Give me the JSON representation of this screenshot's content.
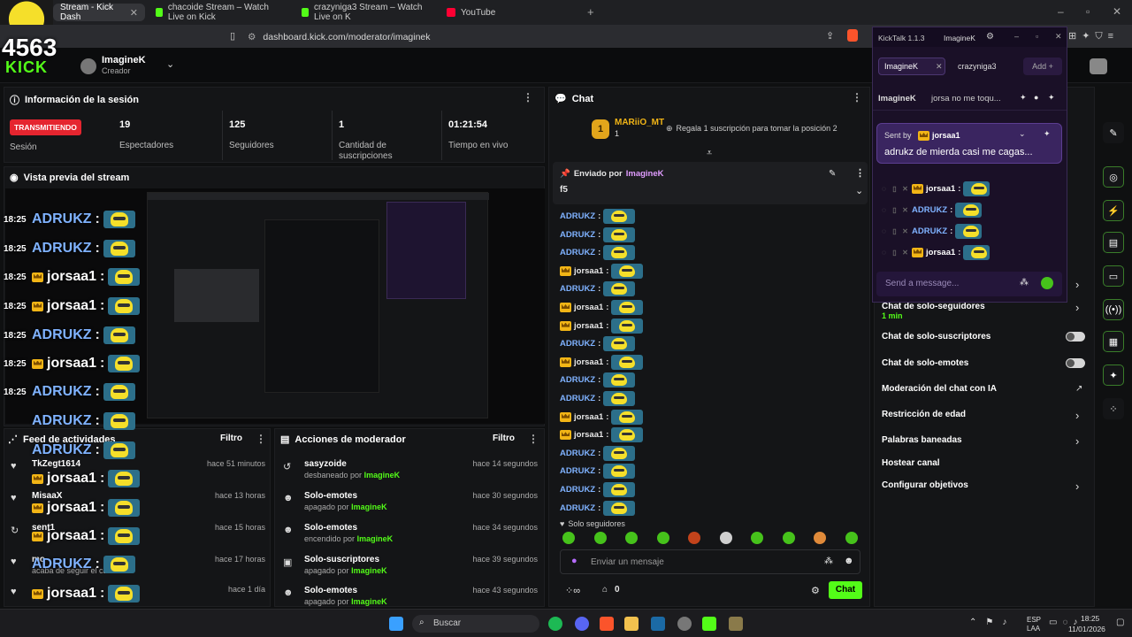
{
  "browser": {
    "tabs": [
      {
        "label": "Stream - Kick Dash",
        "active": true,
        "color": "#53fc18"
      },
      {
        "label": "chacoide Stream – Watch Live on Kick",
        "active": false,
        "color": "#53fc18"
      },
      {
        "label": "crazyniga3 Stream – Watch Live on K",
        "active": false,
        "color": "#53fc18"
      },
      {
        "label": "YouTube",
        "active": false,
        "color": "#ff0033"
      }
    ],
    "url": "dashboard.kick.com/moderator/imaginek",
    "overlay_number": "4563"
  },
  "topnav": {
    "logo": "KICK",
    "user": "ImagineK",
    "role": "Creador"
  },
  "session": {
    "title": "Información de la sesión",
    "live_badge": "TRANSMITIENDO",
    "session_label": "Sesión",
    "stats": [
      {
        "value": "19",
        "label": "Espectadores"
      },
      {
        "value": "125",
        "label": "Seguidores"
      },
      {
        "value": "1",
        "label": "Cantidad de suscripciones"
      },
      {
        "value": "01:21:54",
        "label": "Tiempo en vivo"
      }
    ]
  },
  "preview": {
    "title": "Vista previa del stream"
  },
  "overlay_chat": [
    {
      "time": "18:25",
      "name": "ADRUKZ",
      "gold": false
    },
    {
      "time": "18:25",
      "name": "ADRUKZ",
      "gold": false
    },
    {
      "time": "18:25",
      "name": "jorsaa1",
      "gold": true
    },
    {
      "time": "18:25",
      "name": "jorsaa1",
      "gold": true
    },
    {
      "time": "18:25",
      "name": "ADRUKZ",
      "gold": false
    },
    {
      "time": "18:25",
      "name": "jorsaa1",
      "gold": true
    },
    {
      "time": "18:25",
      "name": "ADRUKZ",
      "gold": false
    },
    {
      "time": "",
      "name": "ADRUKZ",
      "gold": false
    },
    {
      "time": "",
      "name": "ADRUKZ",
      "gold": false
    },
    {
      "time": "",
      "name": "jorsaa1",
      "gold": true
    },
    {
      "time": "",
      "name": "jorsaa1",
      "gold": true
    },
    {
      "time": "",
      "name": "jorsaa1",
      "gold": true
    },
    {
      "time": "",
      "name": "ADRUKZ",
      "gold": false
    },
    {
      "time": "",
      "name": "jorsaa1",
      "gold": true
    }
  ],
  "feed": {
    "title": "Feed de actividades",
    "filter": "Filtro",
    "items": [
      {
        "name": "TkZegt1614",
        "sub": "",
        "ago": "hace 51 minutos"
      },
      {
        "name": "MisaaX",
        "sub": "",
        "ago": "hace 13 horas"
      },
      {
        "name": "sent1",
        "sub": "",
        "ago": "hace 15 horas"
      },
      {
        "name": "mo",
        "sub": "acaba de seguir el canal",
        "ago": "hace 17 horas"
      },
      {
        "name": "",
        "sub": "",
        "ago": "hace 1 día"
      }
    ]
  },
  "modactions": {
    "title": "Acciones de moderador",
    "filter": "Filtro",
    "items": [
      {
        "name": "sasyzoide",
        "sub": "desbaneado por",
        "by": "ImagineK",
        "ago": "hace 14 segundos",
        "icon": "↺"
      },
      {
        "name": "Solo-emotes",
        "sub": "apagado por",
        "by": "ImagineK",
        "ago": "hace 30 segundos",
        "icon": "☻"
      },
      {
        "name": "Solo-emotes",
        "sub": "encendido por",
        "by": "ImagineK",
        "ago": "hace 34 segundos",
        "icon": "☻"
      },
      {
        "name": "Solo-suscriptores",
        "sub": "apagado por",
        "by": "ImagineK",
        "ago": "hace 39 segundos",
        "icon": "▣"
      },
      {
        "name": "Solo-emotes",
        "sub": "apagado por",
        "by": "ImagineK",
        "ago": "hace 43 segundos",
        "icon": "☻"
      }
    ]
  },
  "chat": {
    "title": "Chat",
    "top_gifter": "MARiiO_MT",
    "top_gifter_count": "1",
    "gift_cta": "Regala 1 suscripción para tomar la posición 2",
    "pinned_prefix": "Enviado por",
    "pinned_by": "ImagineK",
    "pinned_text": "f5",
    "lines": [
      "ADRUKZ",
      "ADRUKZ",
      "ADRUKZ",
      "jorsaa1",
      "ADRUKZ",
      "jorsaa1",
      "jorsaa1",
      "ADRUKZ",
      "jorsaa1",
      "ADRUKZ",
      "ADRUKZ",
      "jorsaa1",
      "jorsaa1",
      "ADRUKZ",
      "ADRUKZ",
      "ADRUKZ",
      "ADRUKZ"
    ],
    "mode": "Solo seguidores",
    "placeholder": "Enviar un mensaje",
    "count": "0",
    "send": "Chat"
  },
  "modsettings": {
    "rows": [
      {
        "label": "Chat de solo-seguidores",
        "sub": "1 min",
        "type": "chevron"
      },
      {
        "label": "Chat de solo-suscriptores",
        "sub": "",
        "type": "toggle"
      },
      {
        "label": "Chat de solo-emotes",
        "sub": "",
        "type": "toggle"
      },
      {
        "label": "Moderación del chat con IA",
        "sub": "",
        "type": "external"
      },
      {
        "label": "Restricción de edad",
        "sub": "",
        "type": "chevron"
      },
      {
        "label": "Palabras baneadas",
        "sub": "",
        "type": "chevron"
      },
      {
        "label": "Hostear canal",
        "sub": "",
        "type": "none"
      },
      {
        "label": "Configurar objetivos",
        "sub": "",
        "type": "chevron"
      }
    ]
  },
  "kicktalk": {
    "title": "KickTalk 1.1.3",
    "user": "ImagineK",
    "tabs": [
      "ImagineK",
      "crazyniga3"
    ],
    "add": "Add",
    "pinned_user": "ImagineK",
    "pinned_text": "jorsa no me toqu...",
    "sent_by": "Sent by",
    "sent_by_user": "jorsaa1",
    "reply_text": "adrukz de mierda casi me cagas...",
    "messages": [
      "jorsaa1",
      "ADRUKZ",
      "ADRUKZ",
      "jorsaa1"
    ],
    "placeholder": "Send a message..."
  },
  "taskbar": {
    "search": "Buscar",
    "lang": "ESP",
    "region": "LAA",
    "time": "18:25",
    "date": "11/01/2026"
  }
}
